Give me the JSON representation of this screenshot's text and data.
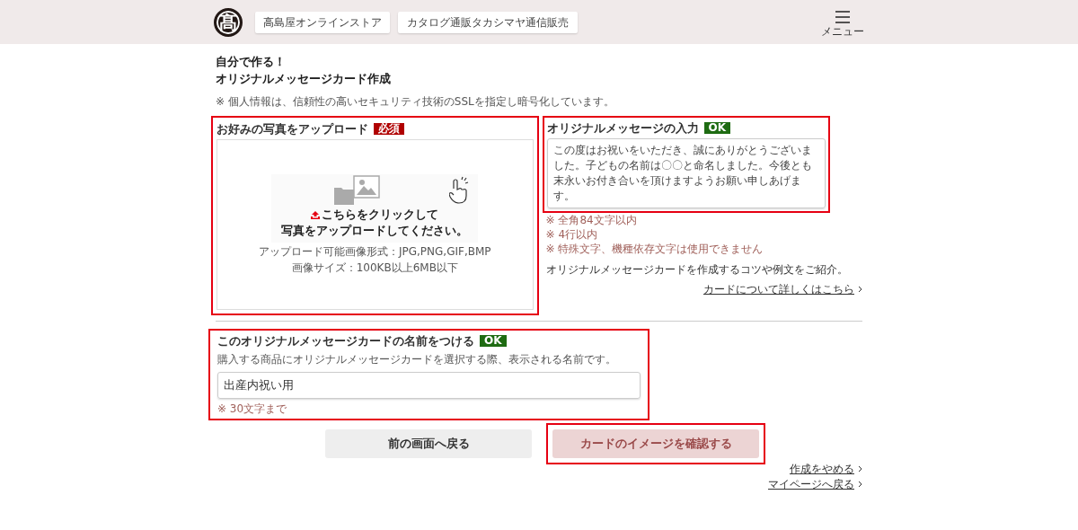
{
  "header": {
    "logo": "髙",
    "nav_buttons": [
      "高島屋オンラインストア",
      "カタログ通販タカシマヤ通信販売"
    ],
    "menu_label": "メニュー"
  },
  "title_lines": [
    "自分で作る！",
    "オリジナルメッセージカード作成"
  ],
  "security_note": "※ 個人情報は、信頼性の高いセキュリティ技術のSSLを指定し暗号化しています。",
  "upload": {
    "highlighted": true,
    "label": "お好みの写真をアップロード",
    "badge": {
      "kind": "required",
      "text": "必須"
    },
    "prompt_lines": [
      "こちらをクリックして",
      "写真をアップロードしてください。"
    ],
    "info_lines": [
      "アップロード可能画像形式：JPG,PNG,GIF,BMP",
      "画像サイズ：100KB以上6MB以下"
    ]
  },
  "message": {
    "highlighted": true,
    "label": "オリジナルメッセージの入力",
    "badge": {
      "kind": "ok",
      "text": "OK"
    },
    "value": "この度はお祝いをいただき、誠にありがとうございました。子どもの名前は〇〇と命名しました。今後とも末永いお付き合いを頂けますようお願い申しあげます。",
    "notes": [
      "※ 全角84文字以内",
      "※ 4行以内",
      "※ 特殊文字、機種依存文字は使用できません"
    ],
    "tips": "オリジナルメッセージカードを作成するコツや例文をご紹介。",
    "link": "カードについて詳しくはこちら"
  },
  "card_name": {
    "highlighted": true,
    "label": "このオリジナルメッセージカードの名前をつける",
    "badge": {
      "kind": "ok",
      "text": "OK"
    },
    "description": "購入する商品にオリジナルメッセージカードを選択する際、表示される名前です。",
    "value": "出産内祝い用",
    "note": "※ 30文字まで"
  },
  "buttons": [
    {
      "label": "前の画面へ戻る",
      "kind": "back",
      "disabled": false,
      "highlighted": false
    },
    {
      "label": "カードのイメージを確認する",
      "kind": "confirm",
      "disabled": true,
      "highlighted": true
    }
  ],
  "footer_links": [
    "作成をやめる",
    "マイページへ戻る"
  ]
}
